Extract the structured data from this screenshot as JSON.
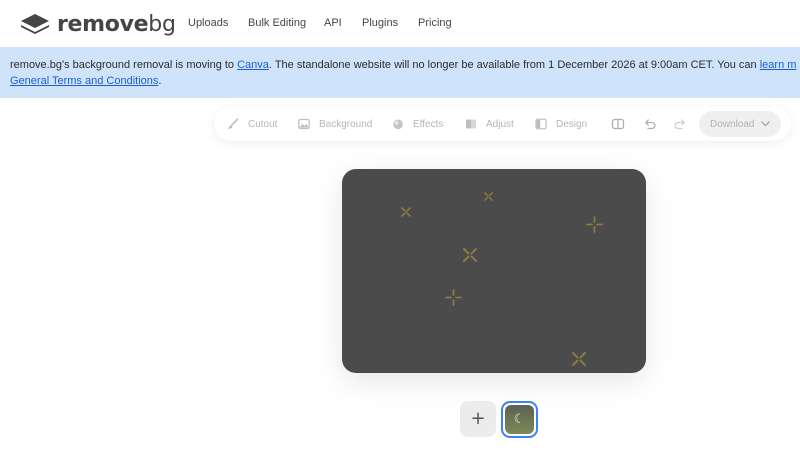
{
  "app": {
    "logo_text_bold": "remove",
    "logo_text_light": "bg"
  },
  "nav": {
    "items": [
      "Uploads",
      "Bulk Editing",
      "API",
      "Plugins",
      "Pricing"
    ]
  },
  "banner": {
    "text_before_link": "remove.bg's background removal is moving to ",
    "link_canva": "Canva",
    "text_after_link": ". The standalone website will no longer be available from 1 December 2026 at 9:00am CET. You can ",
    "link_learn": "learn m",
    "link_terms": "General Terms and Conditions",
    "text_end": "."
  },
  "toolbar": {
    "tools": [
      "Cutout",
      "Background",
      "Effects",
      "Adjust",
      "Design"
    ],
    "icons": [
      "compare-icon",
      "undo-icon",
      "redo-icon"
    ],
    "download_label": "Download"
  },
  "editor": {
    "image_background_color": "#4b4b4b",
    "sparkle_color": "#8c7a45"
  },
  "thumbnails": {
    "add_label": "+",
    "loading_glyph": "☾"
  },
  "colors": {
    "banner_bg": "#cfe3fb",
    "link": "#1b5fd1",
    "thumb_border": "#3b82f6"
  }
}
